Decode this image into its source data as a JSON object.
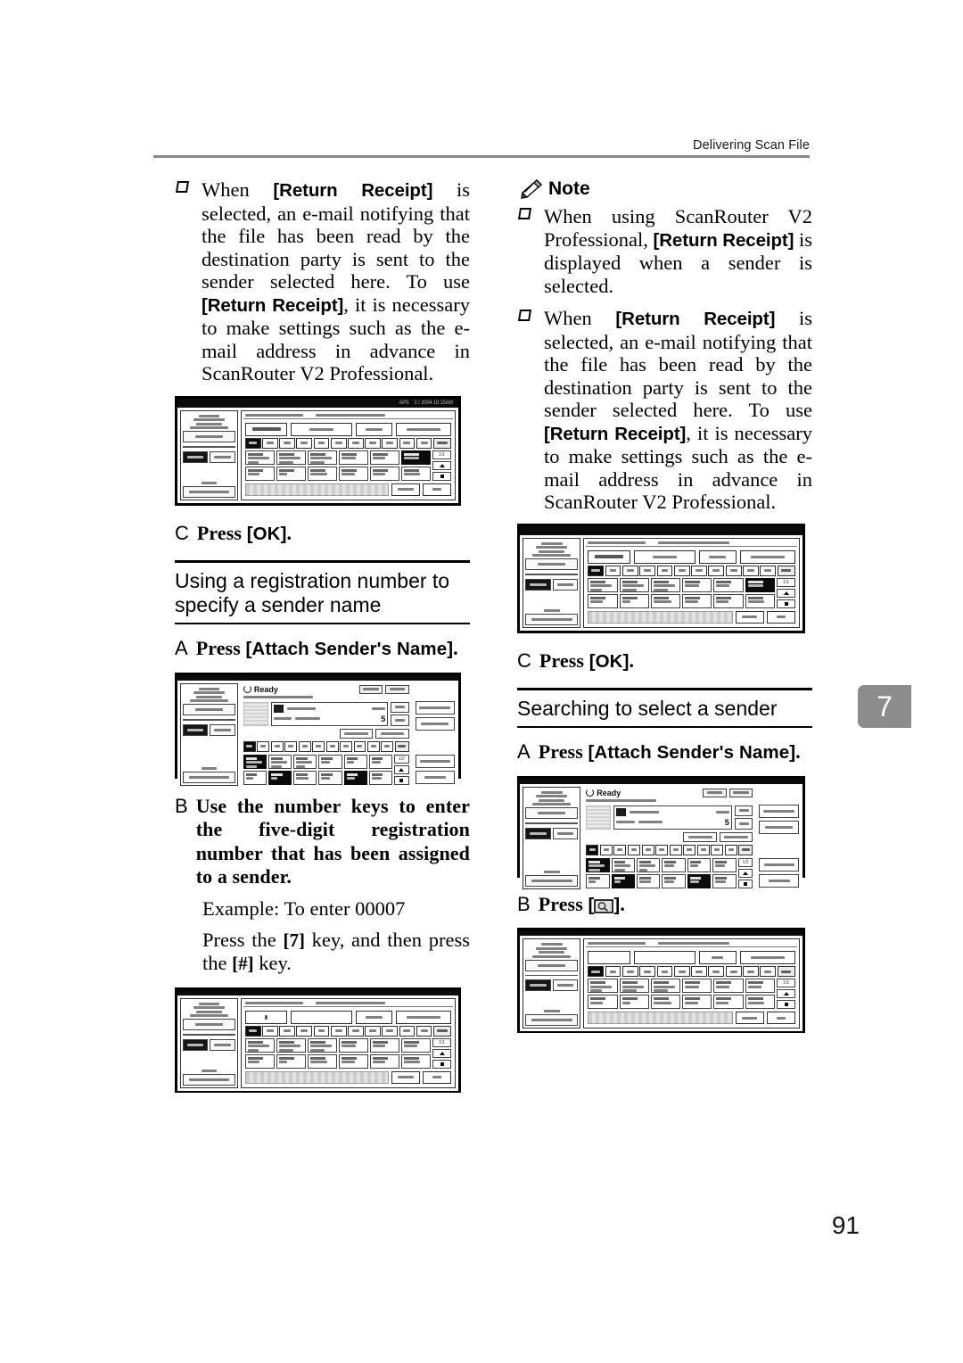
{
  "header": {
    "running_title": "Delivering Scan File"
  },
  "folio": {
    "page_number": "91"
  },
  "chapter_tab": {
    "number": "7"
  },
  "left_column": {
    "bullet_return_receipt": {
      "text_1": "When ",
      "ui_1": "[Return Receipt]",
      "text_2": " is selected, an e-mail notifying that the file has been read by the destination party is sent to the sender selected here. To use ",
      "ui_2": "[Return Receipt]",
      "text_3": ", it is necessary to make settings such as the e-mail address in advance in ScanRouter V2 Professional."
    },
    "figure_1": {
      "caption": "operation-panel-attach-senders-name-screen",
      "status_bar_left": "APS",
      "status_bar_right": "2 / 2004  10:15AM",
      "panel_title_left": "Attach Sender's Name",
      "panel_title_right": "Select name to be attached.",
      "entry_value": "01000007",
      "entry_name": "whoever",
      "clear_label": "Clear",
      "return_receipt_label": "Return Receipt",
      "page_indicator": "1/1",
      "cancel_label": "Cancel",
      "ok_label": "OK"
    },
    "step_c_press_ok": {
      "letter": "C",
      "text": "Press ",
      "ui": "[OK]",
      "suffix": "."
    },
    "section_registration": {
      "title": "Using a registration number to specify a sender name"
    },
    "step_a_attach": {
      "letter": "A",
      "text": "Press ",
      "ui": "[Attach Sender's Name]",
      "suffix": "."
    },
    "figure_2": {
      "caption": "operation-panel-ready-screen",
      "ready_label": "Ready",
      "ready_sub": "Specify the next destination or press Start.",
      "memory_label": "Memory 99%",
      "chip_1": "Preview/ Scan Status",
      "chip_2": "Simple Senders Name",
      "destination_label": "Fresh",
      "destination_sub": "Dry uk",
      "dest_count_label": "Dest.",
      "dest_count_value": "5",
      "registration_no_label": "Registration No.",
      "manual_input_label": "Manual Input",
      "right_rail_1": "Attach Sender's Name",
      "right_rail_2": "Attach Subject",
      "right_rail_3": "Select Stored File",
      "right_rail_4": "Store File",
      "page_indicator": "1/2"
    },
    "step_b_number_keys": {
      "letter": "B",
      "text": "Use the number keys to enter the five-digit registration number that has been assigned to a sender.",
      "example": "Example: To enter 00007",
      "instruction_1": "Press the ",
      "key_1": "7",
      "instruction_2": " key, and then press the ",
      "key_2": "#",
      "instruction_3": " key."
    },
    "figure_3": {
      "caption": "operation-panel-registration-number-entered",
      "panel_title_left": "Attach Sender's Name",
      "panel_title_right": "Select name to be attached.",
      "entry_value": "7",
      "clear_label": "Clear",
      "return_receipt_label": "Return Receipt",
      "page_indicator": "1/1",
      "cancel_label": "Cancel",
      "ok_label": "OK"
    }
  },
  "right_column": {
    "note": {
      "icon": "pencil-icon",
      "label": "Note",
      "bullet_1": {
        "text_1": "When using ScanRouter V2 Professional, ",
        "ui_1": "[Return Receipt]",
        "text_2": " is displayed when a sender is selected."
      },
      "bullet_2": {
        "text_1": "When ",
        "ui_1": "[Return Receipt]",
        "text_2": " is selected, an e-mail notifying that the file has been read by the destination party is sent to the sender selected here. To use ",
        "ui_2": "[Return Receipt]",
        "text_3": ", it is necessary to make settings such as the e-mail address in advance in ScanRouter V2 Professional."
      }
    },
    "figure_4": {
      "caption": "operation-panel-attach-senders-name-screen",
      "panel_title_left": "Attach Sender's Name",
      "panel_title_right": "Select name to be attached.",
      "entry_value": "01000007",
      "entry_name": "whoever",
      "clear_label": "Clear",
      "return_receipt_label": "Return Receipt",
      "page_indicator": "1/1",
      "cancel_label": "Cancel",
      "ok_label": "OK"
    },
    "step_c_press_ok": {
      "letter": "C",
      "text": "Press ",
      "ui": "[OK]",
      "suffix": "."
    },
    "section_searching": {
      "title": "Searching to select a sender"
    },
    "step_a_attach": {
      "letter": "A",
      "text": "Press ",
      "ui": "[Attach Sender's Name]",
      "suffix": "."
    },
    "figure_5": {
      "caption": "operation-panel-ready-screen",
      "ready_label": "Ready",
      "ready_sub": "Specify the next destination or press Start.",
      "memory_label": "Memory 99%",
      "dest_count_value": "5",
      "page_indicator": "1/2"
    },
    "step_b_press_search": {
      "letter": "B",
      "text": "Press ",
      "icon": "search-key-icon",
      "suffix": "."
    },
    "figure_6": {
      "caption": "operation-panel-search-sender-screen",
      "panel_title_left": "Attach Sender's Name",
      "panel_title_right": "Select name to be attached.",
      "clear_label": "Clear",
      "return_receipt_label": "Return Receipt",
      "page_indicator": "1/1",
      "cancel_label": "Cancel",
      "ok_label": "OK"
    }
  }
}
